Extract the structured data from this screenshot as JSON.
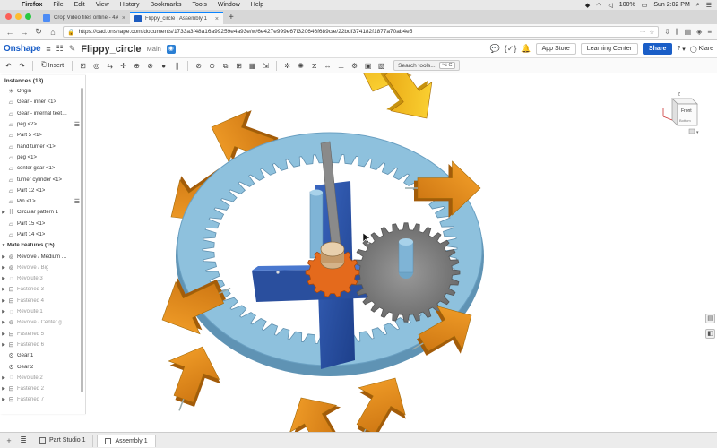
{
  "menubar": {
    "app": "Firefox",
    "items": [
      "File",
      "Edit",
      "View",
      "History",
      "Bookmarks",
      "Tools",
      "Window",
      "Help"
    ],
    "battery": "100%",
    "clock": "Sun 2:02 PM"
  },
  "browser": {
    "tabs": [
      {
        "title": "Crop Video files online - 4A0…",
        "active": false
      },
      {
        "title": "Flippy_circle | Assembly 1",
        "active": true
      }
    ],
    "url": "https://cad.onshape.com/documents/1733a3f48a16a99259e4a93e/w/6e427e999e67f320646f689c/e/22bdf374182f1877a70ab4e5"
  },
  "onshape": {
    "logo": "Onshape",
    "doc_name": "Flippy_circle",
    "branch": "Main",
    "buttons": {
      "app_store": "App Store",
      "learning_center": "Learning Center",
      "share": "Share"
    },
    "user": "Klare",
    "help": "?"
  },
  "toolbar": {
    "insert_label": "Insert",
    "search_label": "Search tools...",
    "search_shortcut": "⌥ C"
  },
  "instances": {
    "header": "Instances (13)",
    "items": [
      {
        "label": "Origin",
        "icon": "origin-icon",
        "muted": false
      },
      {
        "label": "Gear - inner <1>",
        "icon": "part-icon",
        "muted": false
      },
      {
        "label": "Gear - internal teet…",
        "icon": "part-icon",
        "muted": false
      },
      {
        "label": "peg <2>",
        "icon": "part-icon",
        "muted": false,
        "menu": true
      },
      {
        "label": "Part 5 <1>",
        "icon": "part-icon",
        "muted": false
      },
      {
        "label": "hand turner <1>",
        "icon": "part-icon",
        "muted": false
      },
      {
        "label": "peg <1>",
        "icon": "part-icon",
        "muted": false
      },
      {
        "label": "center gear <1>",
        "icon": "part-icon",
        "muted": false
      },
      {
        "label": "turner cylinder <1>",
        "icon": "part-icon",
        "muted": false
      },
      {
        "label": "Part 12 <1>",
        "icon": "part-icon",
        "muted": false
      },
      {
        "label": "Pin <1>",
        "icon": "part-icon",
        "muted": false,
        "menu": true
      },
      {
        "label": "Circular pattern 1",
        "icon": "pattern-icon",
        "muted": false,
        "caret": true
      },
      {
        "label": "Part 15 <1>",
        "icon": "part-icon",
        "muted": false
      },
      {
        "label": "Part 14 <1>",
        "icon": "part-icon",
        "muted": false
      }
    ],
    "mates_header": "Mate Features (15)",
    "mates": [
      {
        "label": "Revolve / Medium …",
        "icon": "revolve-icon",
        "muted": false
      },
      {
        "label": "Revolve / Big",
        "icon": "revolve-icon",
        "muted": true
      },
      {
        "label": "Revolute 3",
        "icon": "revolute-icon",
        "muted": true
      },
      {
        "label": "Fastened 3",
        "icon": "fastened-icon",
        "muted": true
      },
      {
        "label": "Fastened 4",
        "icon": "fastened-icon",
        "muted": true
      },
      {
        "label": "Revolute 1",
        "icon": "revolute-icon",
        "muted": true
      },
      {
        "label": "Revolve / Center g…",
        "icon": "revolve-icon",
        "muted": true
      },
      {
        "label": "Fastened 5",
        "icon": "fastened-icon",
        "muted": true
      },
      {
        "label": "Fastened 6",
        "icon": "fastened-icon",
        "muted": true
      },
      {
        "label": "Gear 1",
        "icon": "gear-relation-icon",
        "muted": false,
        "nocaret": true
      },
      {
        "label": "Gear 2",
        "icon": "gear-relation-icon",
        "muted": false,
        "nocaret": true
      },
      {
        "label": "Revolute 2",
        "icon": "revolute-icon",
        "muted": true
      },
      {
        "label": "Fastened 2",
        "icon": "fastened-icon",
        "muted": true
      },
      {
        "label": "Fastened 7",
        "icon": "fastened-icon",
        "muted": true
      }
    ]
  },
  "viewcube": {
    "top": "Z",
    "front": "Front",
    "bottom": "Bottom"
  },
  "bottom_tabs": [
    {
      "label": "Part Studio 1",
      "active": false
    },
    {
      "label": "Assembly 1",
      "active": true
    }
  ],
  "colors": {
    "onshape_blue": "#1a5ec7",
    "ring": "#8ec1dd",
    "cross": "#2e55a8",
    "center_gear": "#e46a1c",
    "planet_gear": "#8c8c8c",
    "arrow_light": "#f6c416",
    "arrow_dark": "#e48816"
  }
}
